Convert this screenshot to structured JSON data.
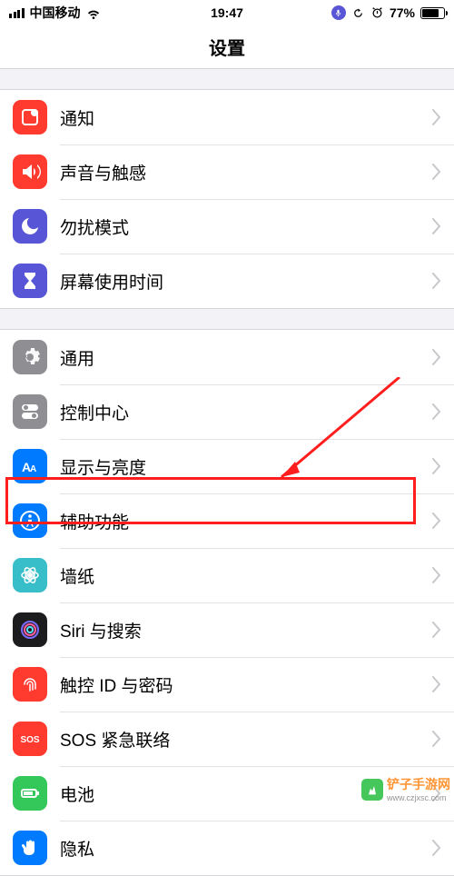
{
  "status": {
    "carrier": "中国移动",
    "time": "19:47",
    "battery_pct": "77%"
  },
  "title": "设置",
  "groups": [
    {
      "rows": [
        {
          "id": "notifications",
          "label": "通知",
          "icon": "notifications-icon",
          "color": "#ff3b30"
        },
        {
          "id": "sounds",
          "label": "声音与触感",
          "icon": "sounds-icon",
          "color": "#ff3b30"
        },
        {
          "id": "dnd",
          "label": "勿扰模式",
          "icon": "moon-icon",
          "color": "#5856d6"
        },
        {
          "id": "screentime",
          "label": "屏幕使用时间",
          "icon": "hourglass-icon",
          "color": "#5856d6"
        }
      ]
    },
    {
      "rows": [
        {
          "id": "general",
          "label": "通用",
          "icon": "gear-icon",
          "color": "#8e8e93"
        },
        {
          "id": "control",
          "label": "控制中心",
          "icon": "switches-icon",
          "color": "#8e8e93"
        },
        {
          "id": "display",
          "label": "显示与亮度",
          "icon": "text-size-icon",
          "color": "#007aff"
        },
        {
          "id": "accessibility",
          "label": "辅助功能",
          "icon": "accessibility-icon",
          "color": "#007aff",
          "highlight": true
        },
        {
          "id": "wallpaper",
          "label": "墙纸",
          "icon": "flower-icon",
          "color": "#38bec9"
        },
        {
          "id": "siri",
          "label": "Siri 与搜索",
          "icon": "siri-icon",
          "color": "#1c1c1e"
        },
        {
          "id": "touchid",
          "label": "触控 ID 与密码",
          "icon": "fingerprint-icon",
          "color": "#ff3b30"
        },
        {
          "id": "sos",
          "label": "SOS 紧急联络",
          "icon": "sos-icon",
          "color": "#ff3b30"
        },
        {
          "id": "battery",
          "label": "电池",
          "icon": "battery-icon",
          "color": "#34c759"
        },
        {
          "id": "privacy",
          "label": "隐私",
          "icon": "hand-icon",
          "color": "#007aff"
        }
      ]
    }
  ],
  "watermark": {
    "name": "铲子手游网",
    "url": "www.czjxsc.com"
  }
}
